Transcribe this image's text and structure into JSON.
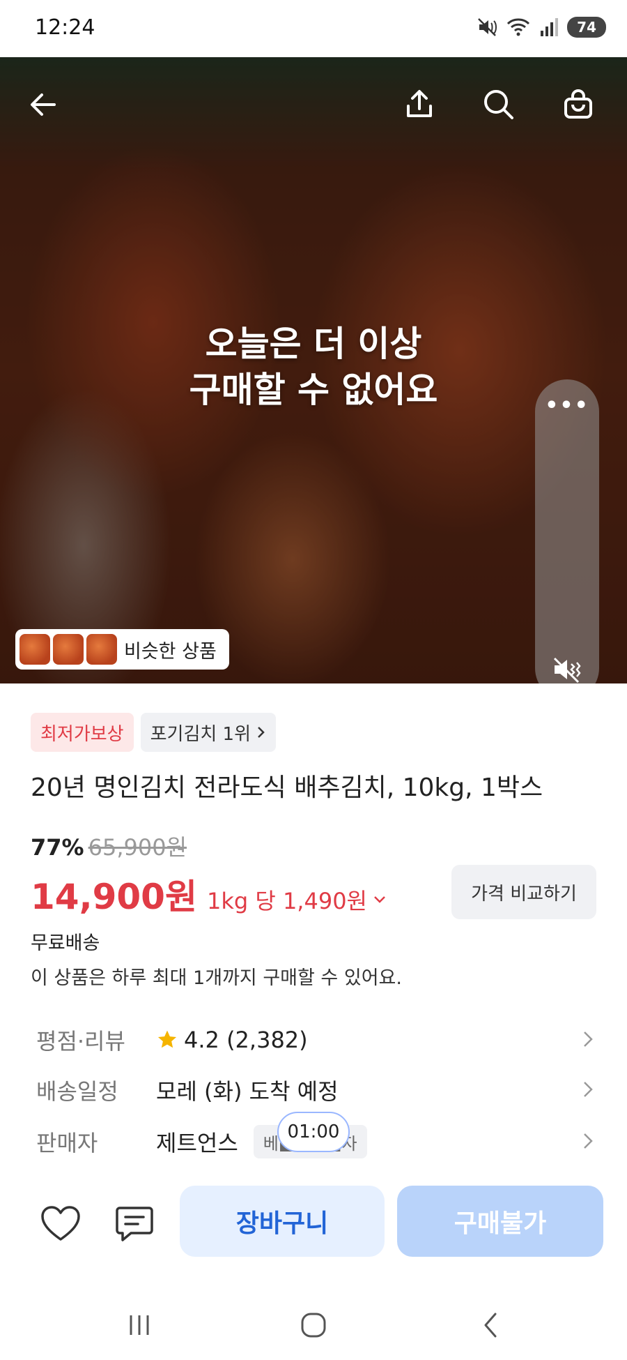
{
  "status_bar": {
    "time": "12:24",
    "battery": "74",
    "icons": [
      "mute-icon",
      "wifi-icon",
      "signal-icon",
      "battery-icon"
    ]
  },
  "hero": {
    "overlay_message_line1": "오늘은 더 이상",
    "overlay_message_line2": "구매할 수 없어요",
    "more_label": "•••",
    "similar_products_label": "비슷한 상품",
    "nav_icons": [
      "back-arrow-icon",
      "share-icon",
      "search-icon",
      "shopping-bag-icon"
    ]
  },
  "product": {
    "badge_lowest_price": "최저가보상",
    "badge_ranking": "포기김치 1위",
    "title": "20년 명인김치 전라도식 배추김치, 10kg, 1박스",
    "discount_percent": "77%",
    "original_price": "65,900원",
    "price": "14,900원",
    "unit_price": "1kg 당 1,490원",
    "compare_button": "가격 비교하기",
    "shipping": "무료배송",
    "purchase_limit": "이 상품은 하루 최대 1개까지 구매할 수 있어요."
  },
  "info_rows": {
    "rating_label": "평점·리뷰",
    "rating_value": "4.2 (2,382)",
    "delivery_label": "배송일정",
    "delivery_value": "모레 (화) 도착 예정",
    "seller_label": "판매자",
    "seller_value": "제트언스",
    "seller_tag": "베■■■■자"
  },
  "timer": "01:00",
  "action_bar": {
    "cart_button": "장바구니",
    "buy_button": "구매불가",
    "icons": [
      "heart-icon",
      "chat-icon"
    ]
  },
  "colors": {
    "accent_red": "#e03b45",
    "accent_blue": "#2264d6",
    "disabled_blue": "#b9d3fa",
    "cart_bg": "#e6f0ff"
  }
}
